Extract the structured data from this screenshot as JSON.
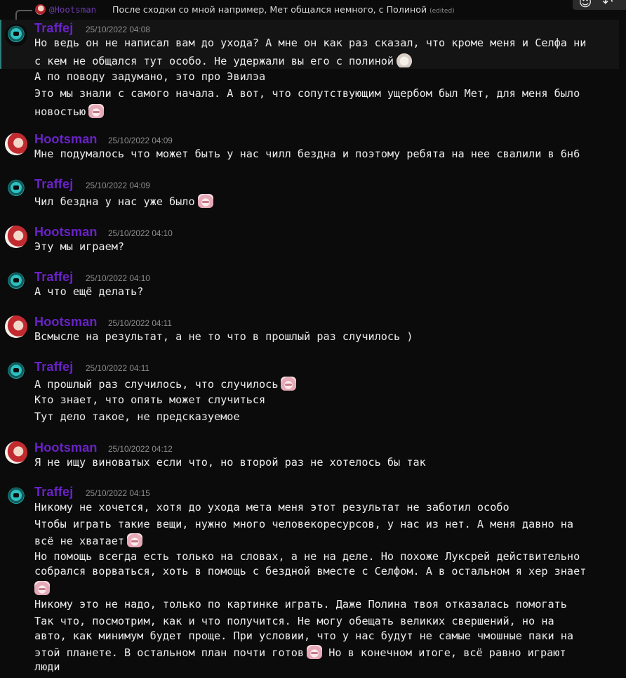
{
  "reply": {
    "mention": "@Hootsman",
    "text": "После сходки со мной например, Мет общался немного, с Полиной",
    "edited": "(edited)"
  },
  "toolbar": {
    "icons": [
      "react-icon",
      "reply-icon"
    ]
  },
  "groups": [
    {
      "author": "Traffej",
      "timestamp": "25/10/2022 04:08",
      "lines": [
        "Но ведь он не написал вам до ухода? А мне он как раз сказал, что кроме меня и Селфа ни",
        "с кем не общался тут особо. Не удержали вы его с полиной",
        "А по поводу задумано, это про Эвилэа",
        "Это мы знали с самого начала. А вот, что сопутствующим ущербом был Мет, для меня было",
        "новостью"
      ]
    },
    {
      "author": "Hootsman",
      "timestamp": "25/10/2022 04:09",
      "lines": [
        "Мне подумалось что может быть у нас чилл бездна и поэтому ребята на нее свалили в 6н6"
      ]
    },
    {
      "author": "Traffej",
      "timestamp": "25/10/2022 04:09",
      "lines": [
        "Чил бездна у нас уже было"
      ]
    },
    {
      "author": "Hootsman",
      "timestamp": "25/10/2022 04:10",
      "lines": [
        "Эту мы играем?"
      ]
    },
    {
      "author": "Traffej",
      "timestamp": "25/10/2022 04:10",
      "lines": [
        "А что ещё делать?"
      ]
    },
    {
      "author": "Hootsman",
      "timestamp": "25/10/2022 04:11",
      "lines": [
        "Всмысле на результат, а не то что в прошлый раз случилось )"
      ]
    },
    {
      "author": "Traffej",
      "timestamp": "25/10/2022 04:11",
      "lines": [
        "А прошлый раз случилось, что случилось",
        "Кто знает, что опять может случиться",
        "Тут дело такое, не предсказуемое"
      ]
    },
    {
      "author": "Hootsman",
      "timestamp": "25/10/2022 04:12",
      "lines": [
        "Я не ищу виноватых если что, но второй раз не хотелось бы так"
      ]
    },
    {
      "author": "Traffej",
      "timestamp": "25/10/2022 04:15",
      "lines": [
        "Никому не хочется, хотя до ухода мета меня этот результат не заботил особо",
        "Чтобы играть такие вещи, нужно много человекоресурсов, у нас из нет. А меня давно на",
        "всё не хватает",
        "Но помощь всегда есть только на словах, а не на деле. Но похоже Лукcрей действительно",
        "собрался ворваться, хоть в помощь с бездной вместе с Селфом. А в остальном я хер знает",
        "",
        "Никому это не надо, только по картинке играть. Даже Полина твоя отказалась помогать",
        "Так что, посмотрим, как и что получится. Не могу обещать великих свершений, но на",
        "авто, как минимум будет проще. При условии, что у нас будут не самые чмошные паки на",
        "этой планете. В остальном план почти готов",
        "Но в конечном итоге, всё равно играют",
        "люди"
      ]
    }
  ]
}
